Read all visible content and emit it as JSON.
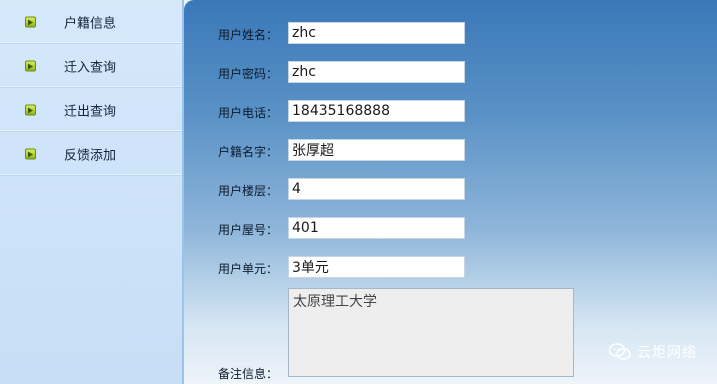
{
  "sidebar": {
    "items": [
      {
        "label": "户籍信息",
        "icon": "arrow-right-icon"
      },
      {
        "label": "迁入查询",
        "icon": "arrow-right-icon"
      },
      {
        "label": "迁出查询",
        "icon": "arrow-right-icon"
      },
      {
        "label": "反馈添加",
        "icon": "arrow-right-icon"
      }
    ]
  },
  "form": {
    "fields": [
      {
        "label": "用户姓名：",
        "value": "zhc"
      },
      {
        "label": "用户密码：",
        "value": "zhc"
      },
      {
        "label": "用户电话：",
        "value": "18435168888"
      },
      {
        "label": "户籍名字：",
        "value": "张厚超"
      },
      {
        "label": "用户楼层：",
        "value": "4"
      },
      {
        "label": "用户屋号：",
        "value": "401"
      },
      {
        "label": "用户单元：",
        "value": "3单元"
      }
    ],
    "notes_label": "备注信息：",
    "notes_value": "太原理工大学"
  },
  "watermark": {
    "text": "云炬网络",
    "icon": "wechat-icon"
  },
  "colors": {
    "sidebar_bg": "#cfe4f9",
    "main_gradient_top": "#3a78b8",
    "main_gradient_bottom": "#eef4fa",
    "icon_green": "#a8c930"
  }
}
